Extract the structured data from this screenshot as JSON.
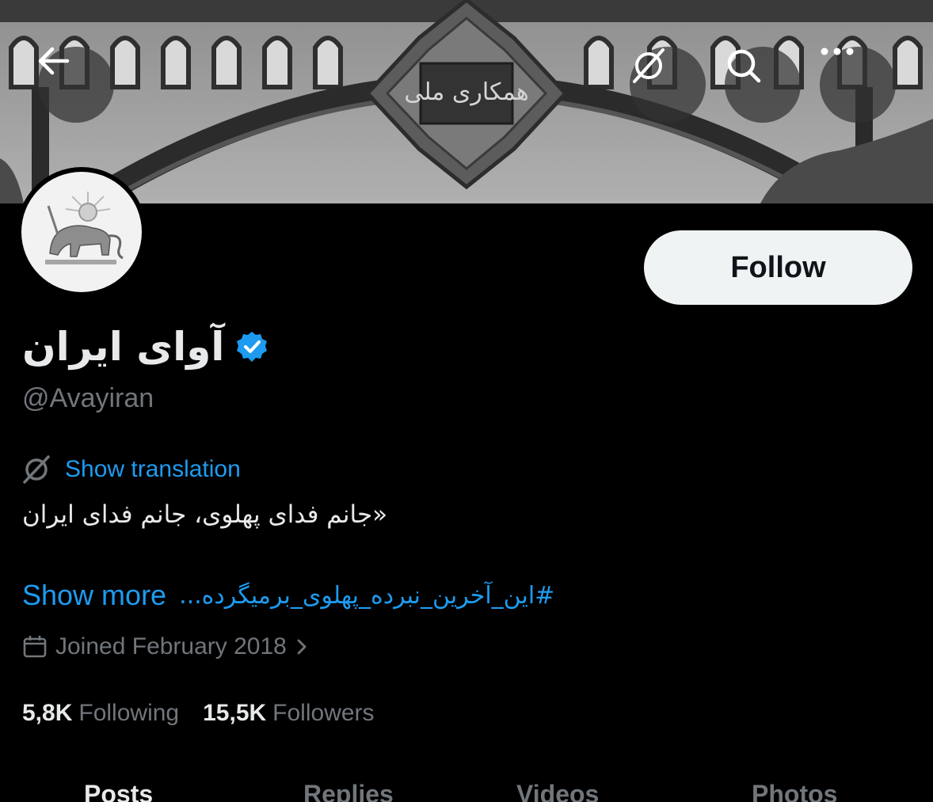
{
  "header": {
    "back_icon": "arrow-left-icon",
    "translate_icon": "translate-icon",
    "search_icon": "search-icon",
    "more_icon": "more-horizontal-icon",
    "banner_emblem_text": "همکاری ملی"
  },
  "profile": {
    "display_name": "آوای ایران",
    "verified": true,
    "verified_color": "#1d9bf0",
    "handle": "@Avayiran",
    "follow_label": "Follow",
    "show_translation_label": "Show translation",
    "bio": "«جانم فدای پهلوی، جانم فدای ایران",
    "hashtag": "#این_آخرین_نبرده_پهلوی_برمیگرده...",
    "show_more_label": "Show more",
    "joined": "Joined February 2018",
    "following_count": "5,8K",
    "following_label": "Following",
    "followers_count": "15,5K",
    "followers_label": "Followers"
  },
  "tabs": [
    {
      "label": "Posts",
      "active": true
    },
    {
      "label": "Replies",
      "active": false
    },
    {
      "label": "Videos",
      "active": false
    },
    {
      "label": "Photos",
      "active": false
    }
  ],
  "colors": {
    "background": "#000000",
    "accent": "#1d9bf0",
    "secondary_text": "#71767b",
    "primary_text": "#e7e9ea",
    "follow_button_bg": "#eff3f4"
  }
}
